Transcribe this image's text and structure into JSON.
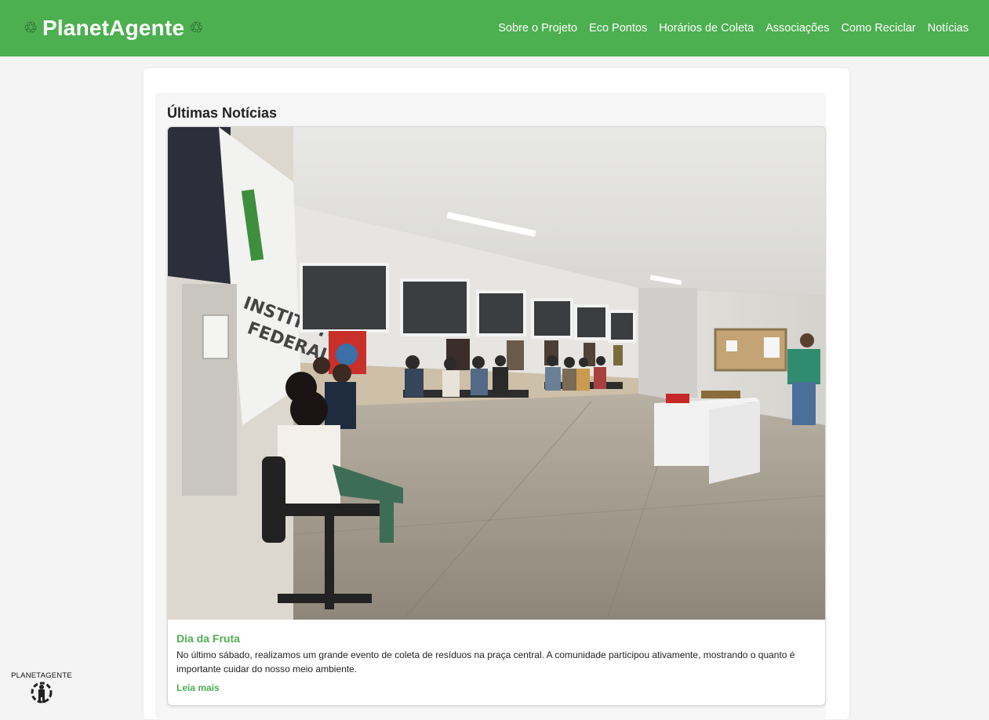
{
  "header": {
    "brand_icon_left": "♲",
    "title": "PlanetAgente",
    "brand_icon_right": "♲",
    "recycle_icon": "recycle-icon",
    "nav": [
      {
        "label": "Sobre o Projeto"
      },
      {
        "label": "Eco Pontos"
      },
      {
        "label": "Horários de Coleta"
      },
      {
        "label": "Associações"
      },
      {
        "label": "Como Reciclar"
      },
      {
        "label": "Notícias"
      }
    ],
    "bg_color": "#4caf50"
  },
  "news": {
    "heading": "Últimas Notícias",
    "items": [
      {
        "title": "Dia da Fruta",
        "text": "No último sábado, realizamos um grande evento de coleta de resíduos na praça central. A comunidade participou ativamente, mostrando o quanto é importante cuidar do nosso meio ambiente.",
        "link_label": "Leia mais"
      }
    ]
  },
  "footer": {
    "logo_text": "PLANETAGENTE"
  },
  "colors": {
    "accent": "#4caf50",
    "page_bg": "#f4f4f4"
  }
}
